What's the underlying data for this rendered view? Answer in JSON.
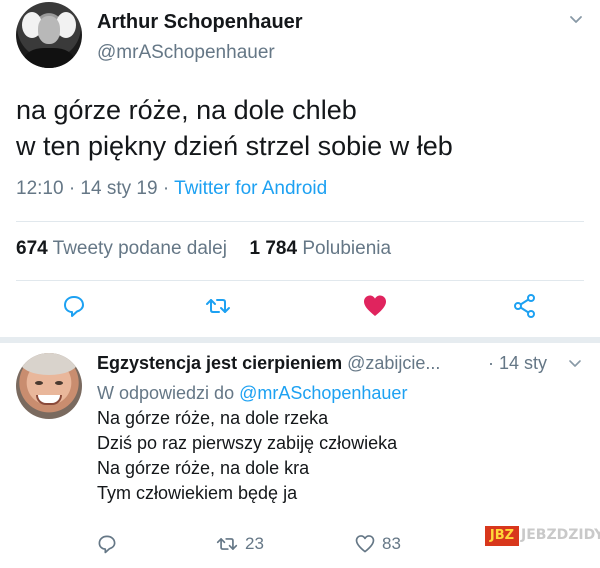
{
  "tweet": {
    "author_name": "Arthur Schopenhauer",
    "author_handle": "@mrASchopenhauer",
    "text": "na górze róże, na dole chleb\nw ten piękny dzień strzel sobie w łeb",
    "time": "12:10 · 14 sty 19 · ",
    "client": "Twitter for Android",
    "retweets_count": "674",
    "retweets_label": "Tweety podane dalej",
    "likes_count": "1 784",
    "likes_label": "Polubienia",
    "liked": true,
    "icons": [
      "reply-icon",
      "retweet-icon",
      "heart-icon",
      "share-icon",
      "chevron-down-icon"
    ]
  },
  "reply": {
    "author_name": "Egzystencja jest cierpieniem",
    "author_handle": "@zabijcie...",
    "time": "· 14 sty",
    "replying_prefix": "W odpowiedzi do ",
    "replying_to": "@mrASchopenhauer",
    "text": "Na górze róże, na dole rzeka\nDziś po raz pierwszy zabiję człowieka\nNa górze róże, na dole kra\nTym człowiekiem będę ja",
    "retweets_count": "23",
    "likes_count": "83"
  },
  "watermark": {
    "badge": "JBZ",
    "text": "JEBZDZIDY"
  },
  "colors": {
    "accent": "#1da1f2",
    "secondary_text": "#657786",
    "like_red": "#e0245e",
    "divider": "#e1e8ed"
  }
}
